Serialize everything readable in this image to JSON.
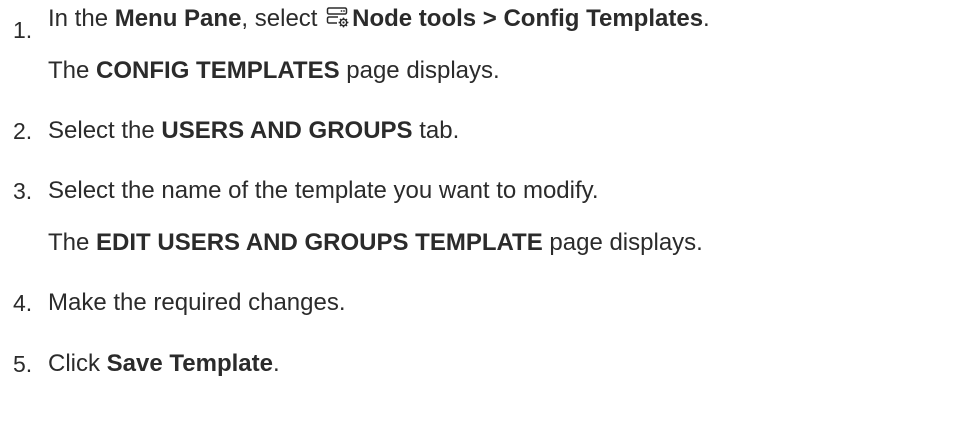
{
  "steps": [
    {
      "number": "1.",
      "text_before": "In the ",
      "bold_1": "Menu Pane",
      "text_mid": ", select ",
      "icon": "node-tools-icon",
      "bold_2": "Node tools > Config Templates",
      "text_after": ".",
      "note_before": "The ",
      "note_bold": "CONFIG TEMPLATES",
      "note_after": " page displays."
    },
    {
      "number": "2.",
      "text_before": "Select the ",
      "bold": "USERS AND GROUPS",
      "text_after": " tab."
    },
    {
      "number": "3.",
      "text": "Select the name of the template you want to modify.",
      "note_before": "The ",
      "note_bold": "EDIT USERS AND GROUPS TEMPLATE",
      "note_after": " page displays."
    },
    {
      "number": "4.",
      "text": "Make the required changes."
    },
    {
      "number": "5.",
      "text_before": "Click ",
      "bold": "Save Template",
      "text_after": "."
    }
  ]
}
